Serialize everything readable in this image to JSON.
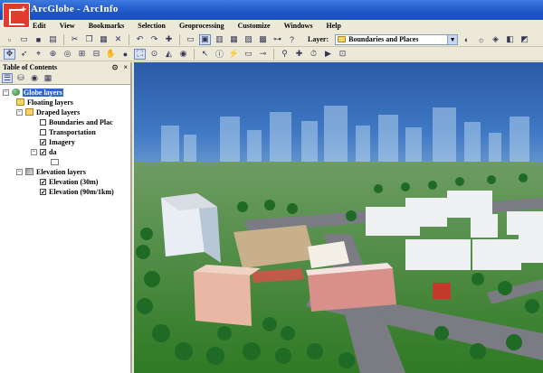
{
  "window": {
    "title": "ArcGlobe - ArcInfo"
  },
  "menu": [
    "Edit",
    "View",
    "Bookmarks",
    "Selection",
    "Geoprocessing",
    "Customize",
    "Windows",
    "Help"
  ],
  "toolbar": {
    "layer_label": "Layer:",
    "layer_value": "Boundaries and Places"
  },
  "toc": {
    "title": "Table of Contents",
    "pin": "⊙",
    "close": "×",
    "root": "Globe layers",
    "floating": "Floating layers",
    "draped": "Draped layers",
    "draped_items": [
      {
        "label": "Boundaries and Plac",
        "checked": false
      },
      {
        "label": "Transportation",
        "checked": false
      },
      {
        "label": "Imagery",
        "checked": true
      },
      {
        "label": "da",
        "checked": true
      }
    ],
    "elevation": "Elevation layers",
    "elevation_items": [
      {
        "label": "Elevation (30m)",
        "checked": true
      },
      {
        "label": "Elevation (90m/1km)",
        "checked": true
      }
    ]
  },
  "colors": {
    "sky": "#2c5da3",
    "grass": "#3a8a2e",
    "road": "#7b7b84",
    "accent_selection": "#316ac5"
  }
}
